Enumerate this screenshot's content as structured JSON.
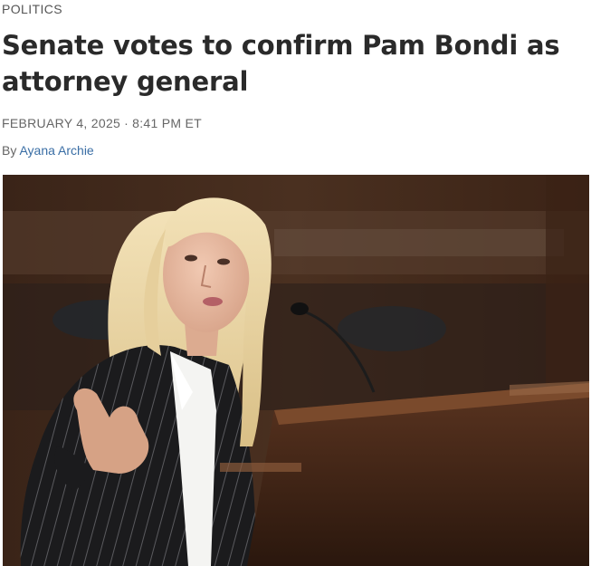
{
  "article": {
    "section": "POLITICS",
    "headline": "Senate votes to confirm Pam Bondi as attorney general",
    "date": "FEBRUARY 4, 2025",
    "date_separator": "·",
    "time": "8:41 PM ET",
    "byline_prefix": "By",
    "author": "Ayana Archie"
  },
  "colors": {
    "headline": "#2a2a2a",
    "meta": "#666666",
    "author_link": "#3a6ea5"
  },
  "photo": {
    "subject": "woman with blonde hair in pinstripe suit speaking at microphone"
  }
}
